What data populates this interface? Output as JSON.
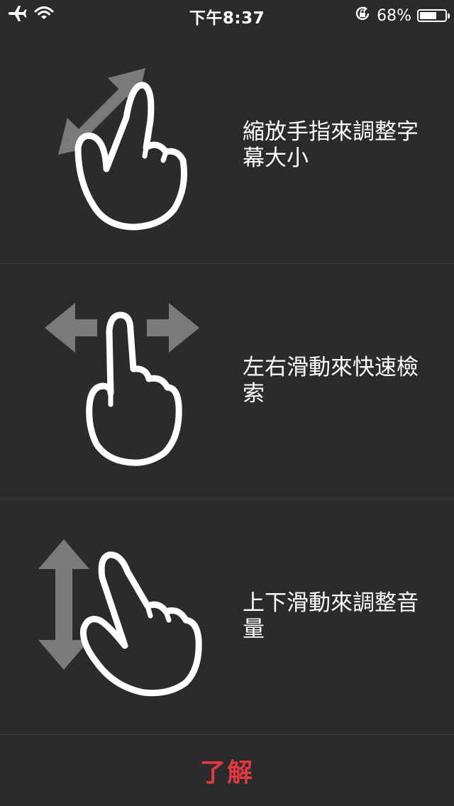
{
  "status_bar": {
    "time": "下午8:37",
    "battery_percent_text": "68%",
    "battery_level": 0.68,
    "icons": [
      "airplane-icon",
      "wifi-icon",
      "rotation-lock-icon",
      "battery-icon"
    ]
  },
  "gestures": [
    {
      "icon": "pinch-zoom-icon",
      "text": "縮放手指來調整字幕大小"
    },
    {
      "icon": "swipe-horizontal-icon",
      "text": "左右滑動來快速檢索"
    },
    {
      "icon": "swipe-vertical-icon",
      "text": "上下滑動來調整音量"
    }
  ],
  "confirm": {
    "label": "了解"
  },
  "colors": {
    "background": "#2b2b2c",
    "divider": "#3c3c3e",
    "arrow": "#7a7a7a",
    "accent": "#e0383e"
  }
}
